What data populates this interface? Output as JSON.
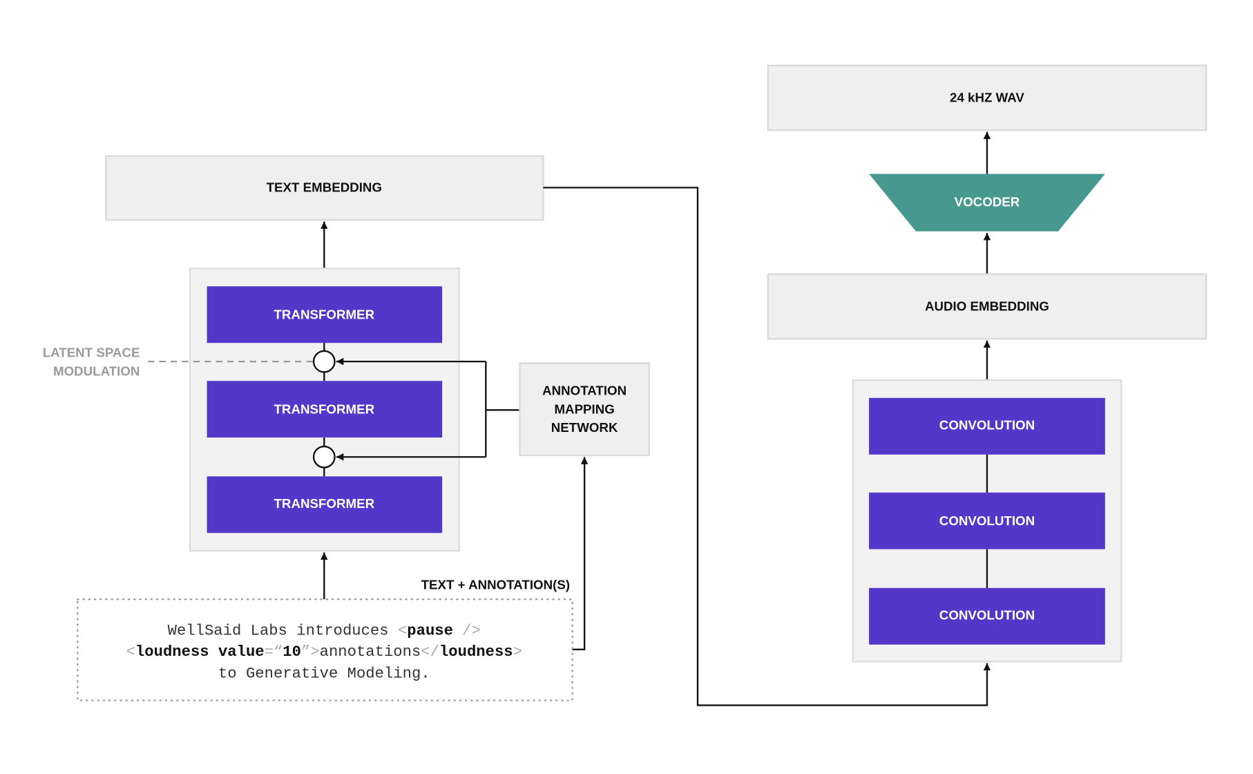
{
  "colors": {
    "block": "#5237c8",
    "vocoder": "#47998f",
    "box": "#efefef",
    "latent_label": "#9a9a9a"
  },
  "left": {
    "text_embedding": "TEXT EMBEDDING",
    "transformers": [
      "TRANSFORMER",
      "TRANSFORMER",
      "TRANSFORMER"
    ],
    "latent_label": [
      "LATENT SPACE",
      "MODULATION"
    ],
    "annotation_network": [
      "ANNOTATION",
      "MAPPING",
      "NETWORK"
    ],
    "input_label": "TEXT + ANNOTATION(S)",
    "input_text": {
      "line1": [
        "WellSaid Labs introduces ",
        "<",
        "pause",
        " />"
      ],
      "line2": [
        "<",
        "loudness value",
        "=“",
        "10",
        "”>",
        "annotations",
        "</",
        "loudness",
        ">"
      ],
      "line3": "to Generative Modeling."
    }
  },
  "right": {
    "output": "24 kHZ WAV",
    "vocoder": "VOCODER",
    "audio_embedding": "AUDIO EMBEDDING",
    "convolutions": [
      "CONVOLUTION",
      "CONVOLUTION",
      "CONVOLUTION"
    ]
  }
}
